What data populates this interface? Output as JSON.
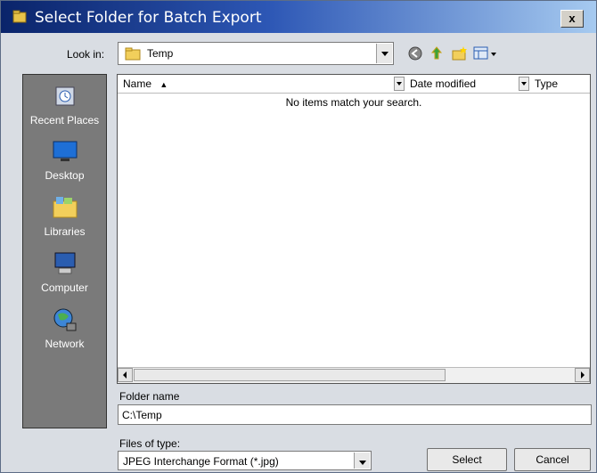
{
  "window": {
    "title": "Select Folder for Batch Export",
    "close_label": "x"
  },
  "toolbar": {
    "look_in_label": "Look in:",
    "look_in_value": "Temp"
  },
  "places": [
    {
      "label": "Recent Places",
      "icon": "recent-places-icon"
    },
    {
      "label": "Desktop",
      "icon": "desktop-icon"
    },
    {
      "label": "Libraries",
      "icon": "libraries-icon"
    },
    {
      "label": "Computer",
      "icon": "computer-icon"
    },
    {
      "label": "Network",
      "icon": "network-icon"
    }
  ],
  "filelist": {
    "columns": [
      "Name",
      "Date modified",
      "Type"
    ],
    "empty_message": "No items match your search."
  },
  "folder_name": {
    "label": "Folder name",
    "value": "C:\\Temp"
  },
  "file_type": {
    "label": "Files of type:",
    "value": "JPEG Interchange Format (*.jpg)"
  },
  "buttons": {
    "select": "Select",
    "cancel": "Cancel"
  },
  "colors": {
    "title_gradient_start": "#0a246a",
    "places_bg": "#7a7a7a",
    "dialog_bg": "#d9dde3"
  }
}
